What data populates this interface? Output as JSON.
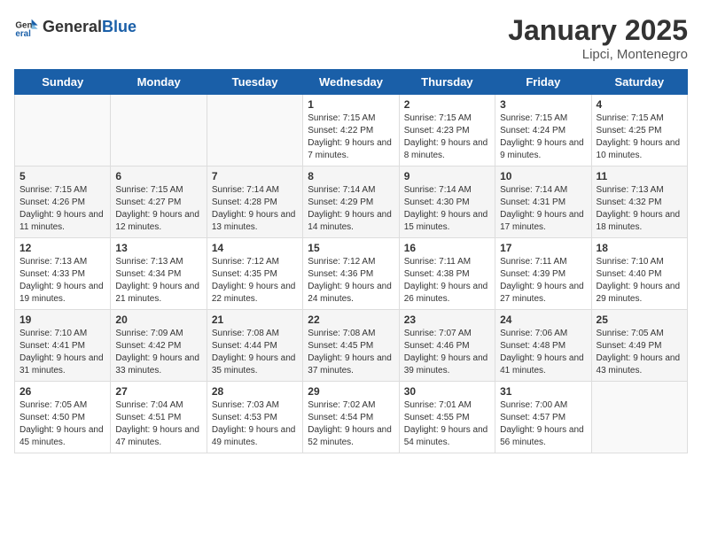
{
  "header": {
    "logo_general": "General",
    "logo_blue": "Blue",
    "month_title": "January 2025",
    "location": "Lipci, Montenegro"
  },
  "days_of_week": [
    "Sunday",
    "Monday",
    "Tuesday",
    "Wednesday",
    "Thursday",
    "Friday",
    "Saturday"
  ],
  "weeks": [
    {
      "days": [
        {
          "num": "",
          "info": ""
        },
        {
          "num": "",
          "info": ""
        },
        {
          "num": "",
          "info": ""
        },
        {
          "num": "1",
          "info": "Sunrise: 7:15 AM\nSunset: 4:22 PM\nDaylight: 9 hours and 7 minutes."
        },
        {
          "num": "2",
          "info": "Sunrise: 7:15 AM\nSunset: 4:23 PM\nDaylight: 9 hours and 8 minutes."
        },
        {
          "num": "3",
          "info": "Sunrise: 7:15 AM\nSunset: 4:24 PM\nDaylight: 9 hours and 9 minutes."
        },
        {
          "num": "4",
          "info": "Sunrise: 7:15 AM\nSunset: 4:25 PM\nDaylight: 9 hours and 10 minutes."
        }
      ]
    },
    {
      "days": [
        {
          "num": "5",
          "info": "Sunrise: 7:15 AM\nSunset: 4:26 PM\nDaylight: 9 hours and 11 minutes."
        },
        {
          "num": "6",
          "info": "Sunrise: 7:15 AM\nSunset: 4:27 PM\nDaylight: 9 hours and 12 minutes."
        },
        {
          "num": "7",
          "info": "Sunrise: 7:14 AM\nSunset: 4:28 PM\nDaylight: 9 hours and 13 minutes."
        },
        {
          "num": "8",
          "info": "Sunrise: 7:14 AM\nSunset: 4:29 PM\nDaylight: 9 hours and 14 minutes."
        },
        {
          "num": "9",
          "info": "Sunrise: 7:14 AM\nSunset: 4:30 PM\nDaylight: 9 hours and 15 minutes."
        },
        {
          "num": "10",
          "info": "Sunrise: 7:14 AM\nSunset: 4:31 PM\nDaylight: 9 hours and 17 minutes."
        },
        {
          "num": "11",
          "info": "Sunrise: 7:13 AM\nSunset: 4:32 PM\nDaylight: 9 hours and 18 minutes."
        }
      ]
    },
    {
      "days": [
        {
          "num": "12",
          "info": "Sunrise: 7:13 AM\nSunset: 4:33 PM\nDaylight: 9 hours and 19 minutes."
        },
        {
          "num": "13",
          "info": "Sunrise: 7:13 AM\nSunset: 4:34 PM\nDaylight: 9 hours and 21 minutes."
        },
        {
          "num": "14",
          "info": "Sunrise: 7:12 AM\nSunset: 4:35 PM\nDaylight: 9 hours and 22 minutes."
        },
        {
          "num": "15",
          "info": "Sunrise: 7:12 AM\nSunset: 4:36 PM\nDaylight: 9 hours and 24 minutes."
        },
        {
          "num": "16",
          "info": "Sunrise: 7:11 AM\nSunset: 4:38 PM\nDaylight: 9 hours and 26 minutes."
        },
        {
          "num": "17",
          "info": "Sunrise: 7:11 AM\nSunset: 4:39 PM\nDaylight: 9 hours and 27 minutes."
        },
        {
          "num": "18",
          "info": "Sunrise: 7:10 AM\nSunset: 4:40 PM\nDaylight: 9 hours and 29 minutes."
        }
      ]
    },
    {
      "days": [
        {
          "num": "19",
          "info": "Sunrise: 7:10 AM\nSunset: 4:41 PM\nDaylight: 9 hours and 31 minutes."
        },
        {
          "num": "20",
          "info": "Sunrise: 7:09 AM\nSunset: 4:42 PM\nDaylight: 9 hours and 33 minutes."
        },
        {
          "num": "21",
          "info": "Sunrise: 7:08 AM\nSunset: 4:44 PM\nDaylight: 9 hours and 35 minutes."
        },
        {
          "num": "22",
          "info": "Sunrise: 7:08 AM\nSunset: 4:45 PM\nDaylight: 9 hours and 37 minutes."
        },
        {
          "num": "23",
          "info": "Sunrise: 7:07 AM\nSunset: 4:46 PM\nDaylight: 9 hours and 39 minutes."
        },
        {
          "num": "24",
          "info": "Sunrise: 7:06 AM\nSunset: 4:48 PM\nDaylight: 9 hours and 41 minutes."
        },
        {
          "num": "25",
          "info": "Sunrise: 7:05 AM\nSunset: 4:49 PM\nDaylight: 9 hours and 43 minutes."
        }
      ]
    },
    {
      "days": [
        {
          "num": "26",
          "info": "Sunrise: 7:05 AM\nSunset: 4:50 PM\nDaylight: 9 hours and 45 minutes."
        },
        {
          "num": "27",
          "info": "Sunrise: 7:04 AM\nSunset: 4:51 PM\nDaylight: 9 hours and 47 minutes."
        },
        {
          "num": "28",
          "info": "Sunrise: 7:03 AM\nSunset: 4:53 PM\nDaylight: 9 hours and 49 minutes."
        },
        {
          "num": "29",
          "info": "Sunrise: 7:02 AM\nSunset: 4:54 PM\nDaylight: 9 hours and 52 minutes."
        },
        {
          "num": "30",
          "info": "Sunrise: 7:01 AM\nSunset: 4:55 PM\nDaylight: 9 hours and 54 minutes."
        },
        {
          "num": "31",
          "info": "Sunrise: 7:00 AM\nSunset: 4:57 PM\nDaylight: 9 hours and 56 minutes."
        },
        {
          "num": "",
          "info": ""
        }
      ]
    }
  ]
}
